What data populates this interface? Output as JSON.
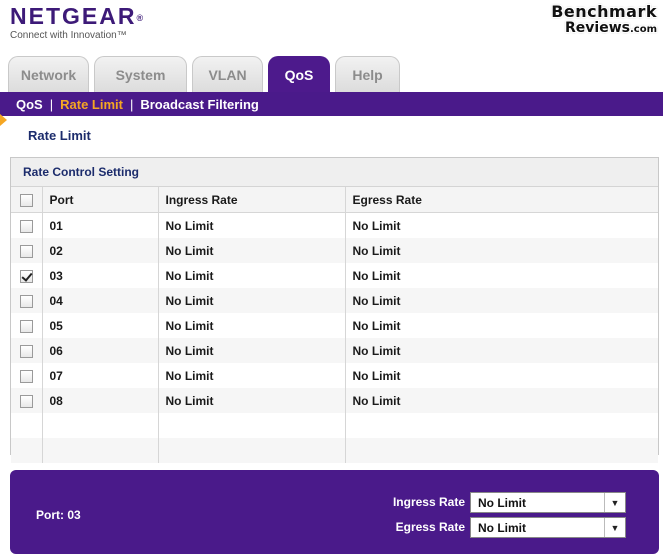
{
  "header": {
    "logo": "NETGEAR",
    "logo_mark": "®",
    "tagline": "Connect with Innovation™",
    "watermark_line1": "Benchmark",
    "watermark_line2": "Reviews",
    "watermark_suffix": ".com"
  },
  "tabs": [
    {
      "label": "Network",
      "active": false
    },
    {
      "label": "System",
      "active": false
    },
    {
      "label": "VLAN",
      "active": false
    },
    {
      "label": "QoS",
      "active": true
    },
    {
      "label": "Help",
      "active": false
    }
  ],
  "subnav": {
    "items": [
      {
        "label": "QoS",
        "active": false
      },
      {
        "label": "Rate Limit",
        "active": true
      },
      {
        "label": "Broadcast Filtering",
        "active": false
      }
    ],
    "separator": "|"
  },
  "page_title": "Rate Limit",
  "panel": {
    "title": "Rate Control Setting",
    "columns": [
      "Port",
      "Ingress Rate",
      "Egress Rate"
    ],
    "rows": [
      {
        "port": "01",
        "ingress": "No Limit",
        "egress": "No Limit",
        "checked": false
      },
      {
        "port": "02",
        "ingress": "No Limit",
        "egress": "No Limit",
        "checked": false
      },
      {
        "port": "03",
        "ingress": "No Limit",
        "egress": "No Limit",
        "checked": true
      },
      {
        "port": "04",
        "ingress": "No Limit",
        "egress": "No Limit",
        "checked": false
      },
      {
        "port": "05",
        "ingress": "No Limit",
        "egress": "No Limit",
        "checked": false
      },
      {
        "port": "06",
        "ingress": "No Limit",
        "egress": "No Limit",
        "checked": false
      },
      {
        "port": "07",
        "ingress": "No Limit",
        "egress": "No Limit",
        "checked": false
      },
      {
        "port": "08",
        "ingress": "No Limit",
        "egress": "No Limit",
        "checked": false
      }
    ]
  },
  "edit": {
    "port_label": "Port: 03",
    "ingress_label": "Ingress Rate",
    "ingress_value": "No Limit",
    "egress_label": "Egress Rate",
    "egress_value": "No Limit"
  },
  "colors": {
    "brand_purple": "#4a1a8a",
    "accent_orange": "#f5a623",
    "title_blue": "#1c2c6c"
  }
}
